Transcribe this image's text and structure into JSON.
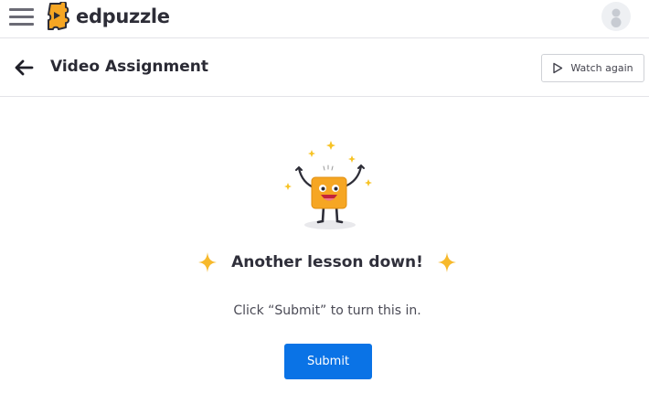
{
  "header": {
    "logo_text": "edpuzzle",
    "icons": {
      "menu": "hamburger-menu-icon",
      "logo": "puzzle-logo-icon",
      "avatar": "user-avatar-icon"
    }
  },
  "subheader": {
    "title": "Video Assignment",
    "back_icon": "arrow-left-icon",
    "watch_again_label": "Watch again",
    "watch_icon": "play-outline-icon"
  },
  "completion": {
    "headline": "Another lesson down!",
    "instructions": "Click “Submit” to turn this in.",
    "submit_label": "Submit",
    "icons": {
      "mascot": "celebrating-mascot-icon",
      "sparkle": "sparkle-icon"
    }
  },
  "colors": {
    "accent": "#0a73e6",
    "brand_orange": "#f6a623",
    "sparkle": "#f7b92b",
    "text": "#2f2f3a"
  }
}
